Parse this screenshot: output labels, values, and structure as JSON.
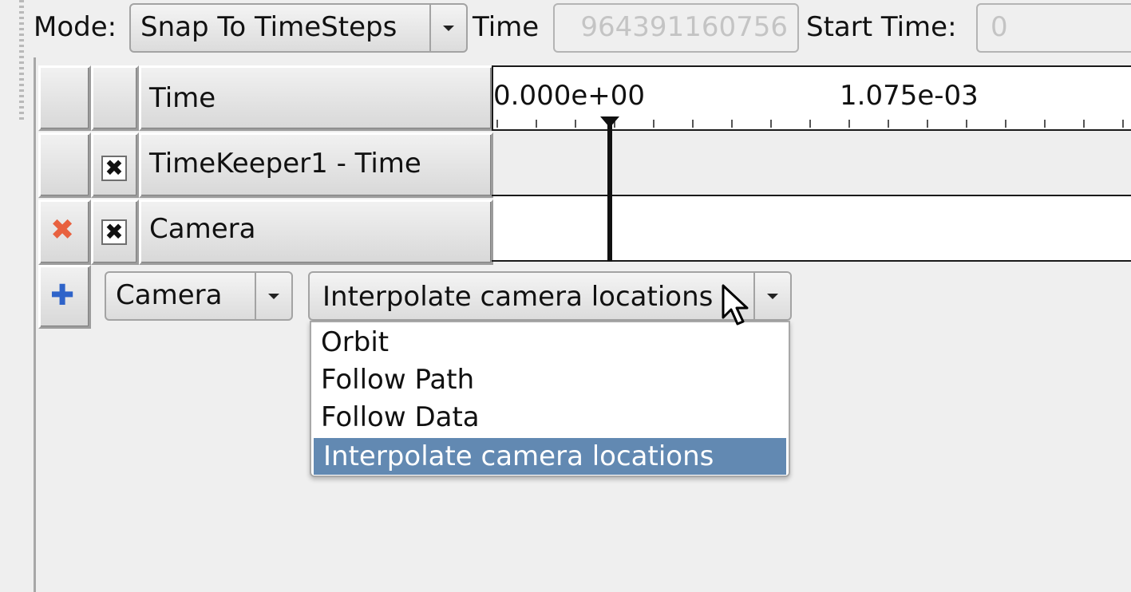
{
  "toolbar": {
    "mode_label": "Mode:",
    "mode_value": "Snap To TimeSteps",
    "time_label": "Time",
    "time_value": "964391160756",
    "start_time_label": "Start Time:",
    "start_time_value": "0"
  },
  "ruler": {
    "tick_labels": [
      "0.000e+00",
      "1.075e-03"
    ]
  },
  "tracks": {
    "header_label": "Time",
    "rows": [
      {
        "label": "TimeKeeper1 - Time",
        "checked_glyph": "✖"
      },
      {
        "label": "Camera",
        "checked_glyph": "✖",
        "delete_glyph": "✖"
      }
    ]
  },
  "add_track": {
    "add_glyph": "✚",
    "source_value": "Camera",
    "mode_value": "Interpolate camera locations",
    "options": [
      "Orbit",
      "Follow Path",
      "Follow Data",
      "Interpolate camera locations"
    ],
    "selected_index": 3
  },
  "colors": {
    "selection": "#6289b2",
    "delete_icon": "#e8613f",
    "add_icon": "#2e63c9"
  },
  "icons": {
    "checkbox": "x-check-icon",
    "delete": "delete-x-icon",
    "add": "plus-icon",
    "cursor": "mouse-pointer-icon"
  }
}
